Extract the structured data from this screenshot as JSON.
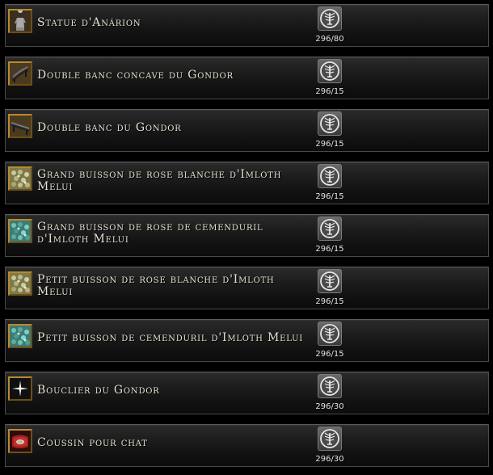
{
  "items": [
    {
      "name": "Statue d'Anárion",
      "cost": "296/80",
      "icon": "statue-icon"
    },
    {
      "name": "Double banc concave du Gondor",
      "cost": "296/15",
      "icon": "curved-bench-icon"
    },
    {
      "name": "Double banc du Gondor",
      "cost": "296/15",
      "icon": "bench-icon"
    },
    {
      "name": "Grand buisson de rose blanche d'Imloth Melui",
      "cost": "296/15",
      "icon": "white-rose-bush-icon"
    },
    {
      "name": "Grand buisson de rose de cemenduril d'Imloth Melui",
      "cost": "296/15",
      "icon": "cemenduril-rose-bush-icon"
    },
    {
      "name": "Petit buisson de rose blanche d'Imloth Melui",
      "cost": "296/15",
      "icon": "white-rose-bush-icon"
    },
    {
      "name": "Petit buisson de cemenduril d'Imloth Melui",
      "cost": "296/15",
      "icon": "cemenduril-rose-bush-icon"
    },
    {
      "name": "Bouclier du Gondor",
      "cost": "296/30",
      "icon": "shield-icon"
    },
    {
      "name": "Coussin pour chat",
      "cost": "296/30",
      "icon": "cushion-icon"
    }
  ],
  "currency_icon": "white-tree-token-icon",
  "colors": {
    "text": "#e8e2d2",
    "icon_frame": "#b98a2e",
    "row_border": "#4a4a4a"
  }
}
